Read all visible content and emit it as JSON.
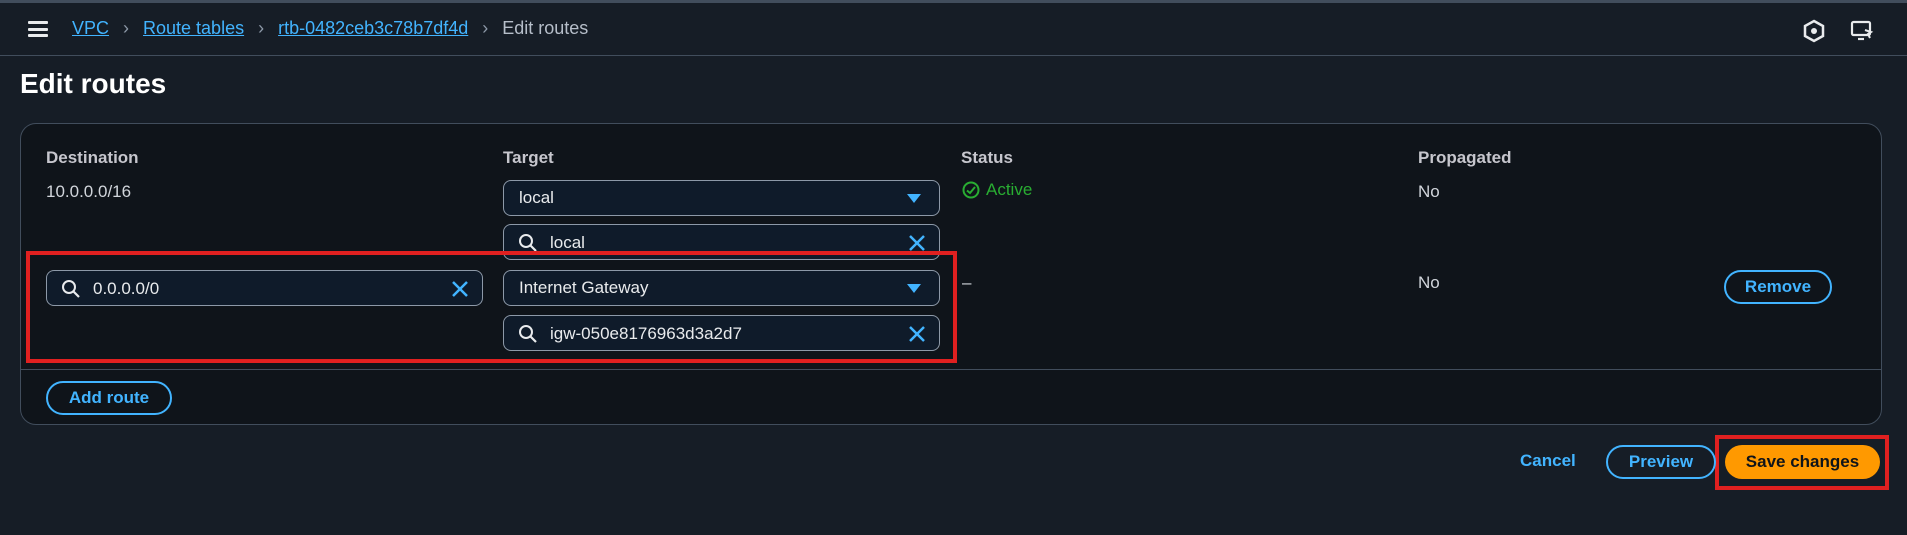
{
  "breadcrumb": {
    "items": [
      "VPC",
      "Route tables",
      "rtb-0482ceb3c78b7df4d"
    ],
    "current": "Edit routes"
  },
  "page": {
    "title": "Edit routes"
  },
  "table": {
    "headers": {
      "destination": "Destination",
      "target": "Target",
      "status": "Status",
      "propagated": "Propagated"
    },
    "rows": [
      {
        "destination": "10.0.0.0/16",
        "target_type": "local",
        "target_search": "local",
        "status": "Active",
        "propagated": "No"
      },
      {
        "destination": "0.0.0.0/0",
        "target_type": "Internet Gateway",
        "target_search": "igw-050e8176963d3a2d7",
        "status": "–",
        "propagated": "No",
        "remove_label": "Remove"
      }
    ]
  },
  "actions": {
    "add_route": "Add route",
    "cancel": "Cancel",
    "preview": "Preview",
    "save": "Save changes"
  },
  "colors": {
    "accent": "#42b4ff",
    "primary": "#ff9900",
    "success": "#29ad32",
    "highlight": "#e02020"
  }
}
